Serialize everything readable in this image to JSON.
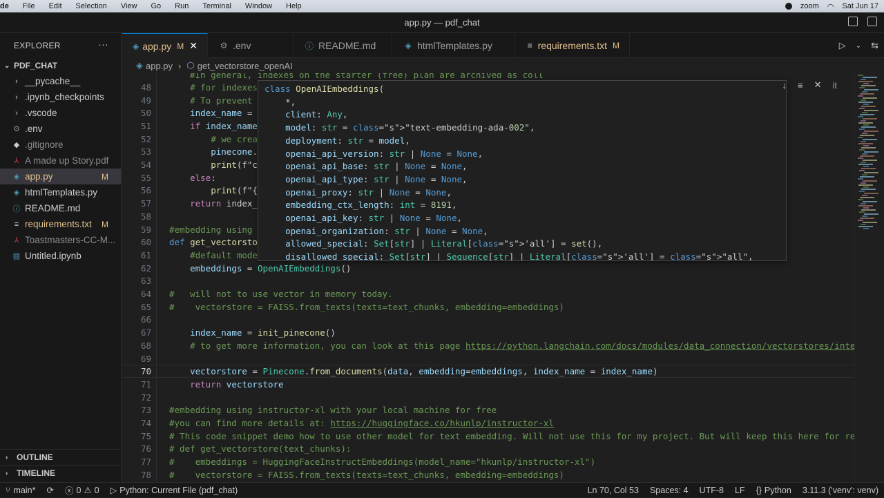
{
  "mac_menubar": {
    "app_letter": "de",
    "items": [
      "File",
      "Edit",
      "Selection",
      "View",
      "Go",
      "Run",
      "Terminal",
      "Window",
      "Help"
    ],
    "zoom_label": "zoom",
    "date": "Sat Jun 17"
  },
  "window": {
    "title": "app.py — pdf_chat"
  },
  "explorer": {
    "title": "EXPLORER",
    "more": "···",
    "folder": "PDF_CHAT",
    "items": [
      {
        "label": "__pycache__",
        "icon": "chevron-right-icon",
        "glyph": "›",
        "badge": ""
      },
      {
        "label": ".ipynb_checkpoints",
        "icon": "chevron-right-icon",
        "glyph": "›",
        "badge": ""
      },
      {
        "label": ".vscode",
        "icon": "chevron-right-icon",
        "glyph": "›",
        "badge": ""
      },
      {
        "label": ".env",
        "icon": "gear-icon",
        "glyph": "⚙",
        "badge": ""
      },
      {
        "label": ".gitignore",
        "icon": "git-icon",
        "glyph": "◆",
        "badge": ""
      },
      {
        "label": "A made up Story.pdf",
        "icon": "pdf-icon",
        "glyph": "⅄",
        "badge": ""
      },
      {
        "label": "app.py",
        "icon": "python-icon",
        "glyph": "◈",
        "badge": "M"
      },
      {
        "label": "htmlTemplates.py",
        "icon": "python-icon",
        "glyph": "◈",
        "badge": ""
      },
      {
        "label": "README.md",
        "icon": "info-icon",
        "glyph": "ⓘ",
        "badge": ""
      },
      {
        "label": "requirements.txt",
        "icon": "list-icon",
        "glyph": "≡",
        "badge": "M"
      },
      {
        "label": "Toastmasters-CC-M...",
        "icon": "pdf-icon",
        "glyph": "⅄",
        "badge": ""
      },
      {
        "label": "Untitled.ipynb",
        "icon": "notebook-icon",
        "glyph": "▤",
        "badge": ""
      }
    ],
    "outline": "OUTLINE",
    "timeline": "TIMELINE"
  },
  "tabs": [
    {
      "label": "app.py",
      "badge": "M",
      "close": "✕",
      "icon": "python-icon",
      "glyph": "◈"
    },
    {
      "label": ".env",
      "badge": "",
      "close": "",
      "icon": "gear-icon",
      "glyph": "⚙"
    },
    {
      "label": "README.md",
      "badge": "",
      "close": "",
      "icon": "info-icon",
      "glyph": "ⓘ"
    },
    {
      "label": "htmlTemplates.py",
      "badge": "",
      "close": "",
      "icon": "python-icon",
      "glyph": "◈"
    },
    {
      "label": "requirements.txt",
      "badge": "M",
      "close": "",
      "icon": "list-icon",
      "glyph": "≡"
    }
  ],
  "breadcrumb": {
    "file": "app.py",
    "symbol": "get_vectorstore_openAI"
  },
  "editor": {
    "current_line": "70",
    "lines": [
      {
        "n": "48",
        "t": "    # for indexes"
      },
      {
        "n": "49",
        "t": "    # To prevent"
      },
      {
        "n": "50",
        "t": "    index_name ="
      },
      {
        "n": "51",
        "t": "    if index_name"
      },
      {
        "n": "52",
        "t": "        # we crea"
      },
      {
        "n": "53",
        "t": "        pinecone."
      },
      {
        "n": "54",
        "t": "        print(f\"c"
      },
      {
        "n": "55",
        "t": "    else:"
      },
      {
        "n": "56",
        "t": "        print(f\"{"
      },
      {
        "n": "57",
        "t": "    return index_"
      },
      {
        "n": "58",
        "t": ""
      },
      {
        "n": "59",
        "t": "#embedding using"
      },
      {
        "n": "60",
        "t": "def get_vectorsto"
      },
      {
        "n": "61",
        "t": "    #default mode"
      },
      {
        "n": "62",
        "t": "    embeddings = OpenAIEmbeddings()"
      },
      {
        "n": "63",
        "t": ""
      },
      {
        "n": "64",
        "t": "#   will not to use vector in memory today."
      },
      {
        "n": "65",
        "t": "#    vectorstore = FAISS.from_texts(texts=text_chunks, embedding=embeddings)"
      },
      {
        "n": "66",
        "t": ""
      },
      {
        "n": "67",
        "t": "    index_name = init_pinecone()"
      },
      {
        "n": "68",
        "t": "    # to get more information, you can look at this page https://python.langchain.com/docs/modules/data_connection/vectorstores/inte"
      },
      {
        "n": "69",
        "t": ""
      },
      {
        "n": "70",
        "t": "    vectorstore = Pinecone.from_documents(data, embedding=embeddings, index_name = index_name)"
      },
      {
        "n": "71",
        "t": "    return vectorstore"
      },
      {
        "n": "72",
        "t": ""
      },
      {
        "n": "73",
        "t": "#embedding using instructor-xl with your local machine for free"
      },
      {
        "n": "74",
        "t": "#you can find more details at: https://huggingface.co/hkunlp/instructor-xl"
      },
      {
        "n": "75",
        "t": "# This code snippet demo how to use other model for text embedding. Will not use this for my project. But will keep this here for re"
      },
      {
        "n": "76",
        "t": "# def get_vectorstore(text_chunks):"
      },
      {
        "n": "77",
        "t": "#    embeddings = HuggingFaceInstructEmbeddings(model_name=\"hkunlp/instructor-xl\")"
      },
      {
        "n": "78",
        "t": "#    vectorstore = FAISS.from_texts(texts=text_chunks, embedding=embeddings)"
      }
    ],
    "top_partial": "#In general, indexes on the starter (free) plan are archived as coll"
  },
  "hover": {
    "lines": [
      "class OpenAIEmbeddings(",
      "    *,",
      "    client: Any,",
      "    model: str = \"text-embedding-ada-002\",",
      "    deployment: str = model,",
      "    openai_api_version: str | None = None,",
      "    openai_api_base: str | None = None,",
      "    openai_api_type: str | None = None,",
      "    openai_proxy: str | None = None,",
      "    embedding_ctx_length: int = 8191,",
      "    openai_api_key: str | None = None,",
      "    openai_organization: str | None = None,",
      "    allowed_special: Set[str] | Literal['all'] = set(),",
      "    disallowed_special: Set[str] | Sequence[str] | Literal['all'] = \"all\","
    ]
  },
  "find_widget": {
    "close": "✕",
    "partial": "it"
  },
  "status": {
    "branch": "main*",
    "errors": "0",
    "warnings": "0",
    "run_config": "Python: Current File (pdf_chat)",
    "position": "Ln 70, Col 53",
    "spaces": "Spaces: 4",
    "encoding": "UTF-8",
    "eol": "LF",
    "language": "Python",
    "interpreter": "3.11.3 ('venv': venv)"
  }
}
